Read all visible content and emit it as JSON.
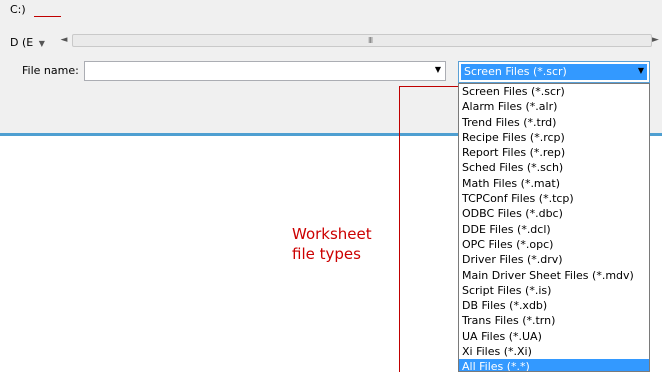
{
  "drives": {
    "c_label": "C:)",
    "d_label": "D (E",
    "d_dropdown": "▼"
  },
  "hscroll": {
    "left_arrow": "◄",
    "grip": "III",
    "right_arrow": "►"
  },
  "file_name": {
    "label": "File name:",
    "value": "",
    "arrow": "▼"
  },
  "file_type": {
    "selected": "Screen Files (*.scr)",
    "arrow": "▼",
    "options": [
      "Screen Files (*.scr)",
      "Alarm Files (*.alr)",
      "Trend Files (*.trd)",
      "Recipe Files (*.rcp)",
      "Report Files (*.rep)",
      "Sched Files (*.sch)",
      "Math Files (*.mat)",
      "TCPConf Files (*.tcp)",
      "ODBC Files (*.dbc)",
      "DDE Files (*.dcl)",
      "OPC Files (*.opc)",
      "Driver Files (*.drv)",
      "Main Driver Sheet Files (*.mdv)",
      "Script Files (*.is)",
      "DB Files (*.xdb)",
      "Trans Files (*.trn)",
      "UA Files (*.UA)",
      "Xi Files (*.Xi)",
      "All Files (*.*)"
    ],
    "highlighted_index": 18
  },
  "annotation": {
    "line1": "Worksheet",
    "line2": "file types"
  },
  "colors": {
    "annotation": "#cc0000",
    "highlight": "#3399ff",
    "accent_border": "#4e9fd1"
  }
}
